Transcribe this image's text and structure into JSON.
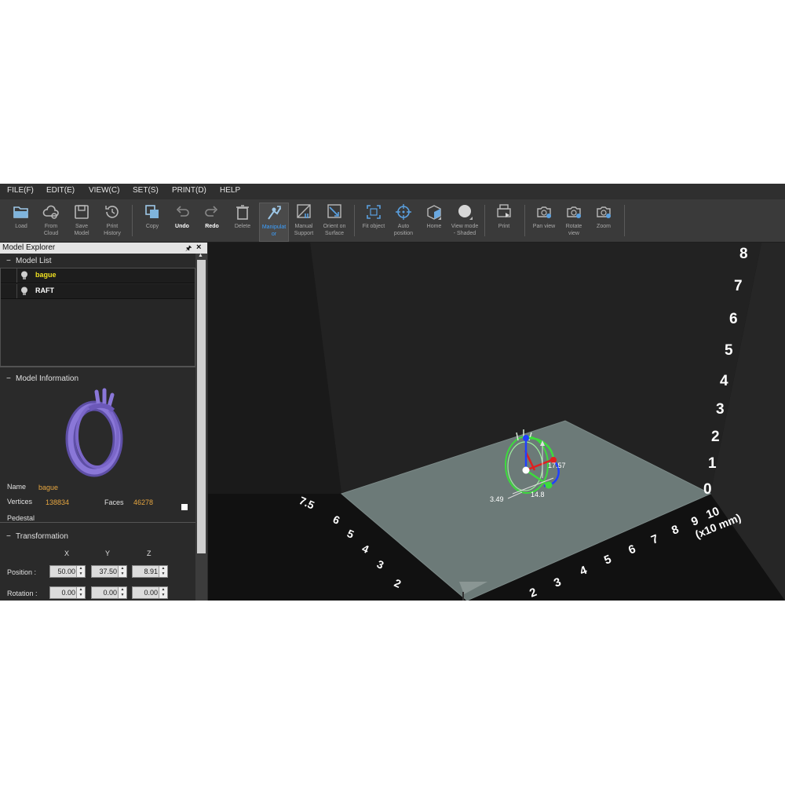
{
  "menu": [
    "FILE(F)",
    "EDIT(E)",
    "VIEW(C)",
    "SET(S)",
    "PRINT(D)",
    "HELP"
  ],
  "toolbar": {
    "load": "Load",
    "from_cloud": "From\nCloud",
    "save_model": "Save\nModel",
    "print_history": "Print\nHistory",
    "copy": "Copy",
    "undo": "Undo",
    "redo": "Redo",
    "delete": "Delete",
    "manipulator": "Manipulat\nor",
    "manual_support": "Manual\nSupport",
    "orient_on_surface": "Orient on\nSurface",
    "fit_object": "Fit object",
    "auto_position": "Auto\nposition",
    "home": "Home",
    "view_mode": "View mode\n- Shaded",
    "print": "Print",
    "pan_view": "Pan view",
    "rotate_view": "Rotate\nview",
    "zoom": "Zoom"
  },
  "panel": {
    "title": "Model Explorer",
    "model_list_title": "Model List",
    "models": [
      {
        "name": "bague",
        "color": "#f0e020"
      },
      {
        "name": "RAFT",
        "color": "#ffffff"
      }
    ],
    "model_info_title": "Model Information",
    "name_label": "Name",
    "name_value": "bague",
    "vertices_label": "Vertices",
    "vertices_value": "138834",
    "faces_label": "Faces",
    "faces_value": "46278",
    "pedestal_label": "Pedestal",
    "transformation_title": "Transformation",
    "axis_x": "X",
    "axis_y": "Y",
    "axis_z": "Z",
    "position_label": "Position :",
    "rotation_label": "Rotation :",
    "position": {
      "x": "50.00",
      "y": "37.50",
      "z": "8.91"
    },
    "rotation": {
      "x": "0.00",
      "y": "0.00",
      "z": "0.00"
    }
  },
  "viewport": {
    "z_ticks": [
      "8",
      "7",
      "6",
      "5",
      "4",
      "3",
      "2",
      "1",
      "0"
    ],
    "x_ticks": [
      "2",
      "3",
      "4",
      "5",
      "6",
      "7",
      "8",
      "9",
      "10"
    ],
    "unit_label": "(x10 mm)",
    "y_ticks": [
      "7.5",
      "6",
      "5",
      "4",
      "3",
      "2"
    ],
    "dims": {
      "height": "17.57",
      "width": "14.8",
      "depth": "3.49"
    }
  },
  "colors": {
    "accent": "#3ca0ff",
    "model_purple": "#7b67c9",
    "bed": "#6c7a78",
    "gizmo_green": "#3cdc3c"
  }
}
